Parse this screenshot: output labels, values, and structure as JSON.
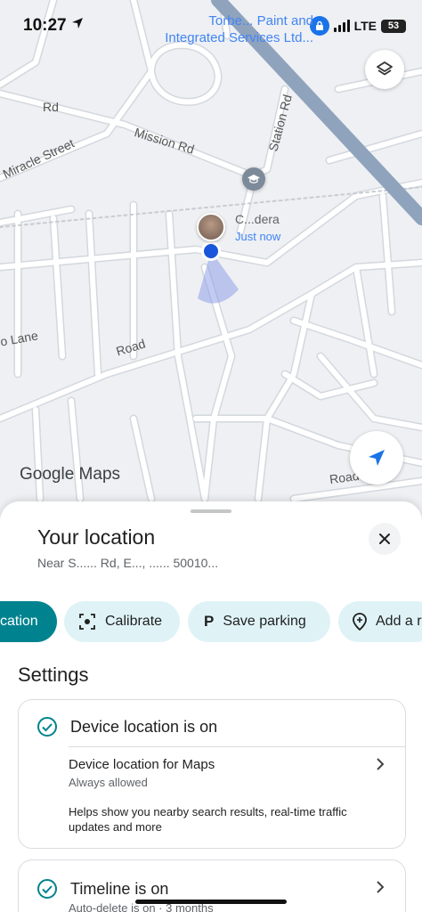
{
  "status_bar": {
    "time": "10:27",
    "network": "LTE",
    "battery": "53"
  },
  "map": {
    "place_label_line1": "Torbe... Paint and",
    "place_label_line2": "Integrated Services Ltd...",
    "road_labels": {
      "rd_top": "Rd",
      "mission_rd": "Mission Rd",
      "miracle_street": "Miracle Street",
      "station_rd": "Station Rd",
      "lane": "o Lane",
      "road_mid": "Road",
      "road_bottom": "Road"
    },
    "person_name": "C...dera",
    "person_status": "Just now",
    "google_maps_logo": "Google Maps",
    "icons": {
      "layers": "layers-icon",
      "locate": "navigation-arrow-icon",
      "school": "school-icon"
    }
  },
  "sheet": {
    "title": "Your location",
    "subtitle": "Near S...... Rd, E..., ...... 50010...",
    "chips": [
      {
        "label": "cation",
        "icon": "",
        "active": true
      },
      {
        "label": "Calibrate",
        "icon": "calibrate-icon",
        "active": false
      },
      {
        "label": "Save parking",
        "icon": "parking-icon",
        "active": false
      },
      {
        "label": "Add a r",
        "icon": "add-place-icon",
        "active": false
      }
    ],
    "settings_heading": "Settings",
    "device_location": {
      "label": "Device location is on",
      "sub_title": "Device location for Maps",
      "sub_caption": "Always allowed",
      "help_text": "Helps show you nearby search results, real-time traffic updates and more"
    },
    "timeline": {
      "label": "Timeline is on",
      "caption": "Auto-delete is on · 3 months"
    }
  },
  "colors": {
    "accent_teal": "#00838f",
    "chip_bg": "#dff3f7",
    "map_bg": "#eef0f3",
    "google_blue": "#4285f4"
  }
}
